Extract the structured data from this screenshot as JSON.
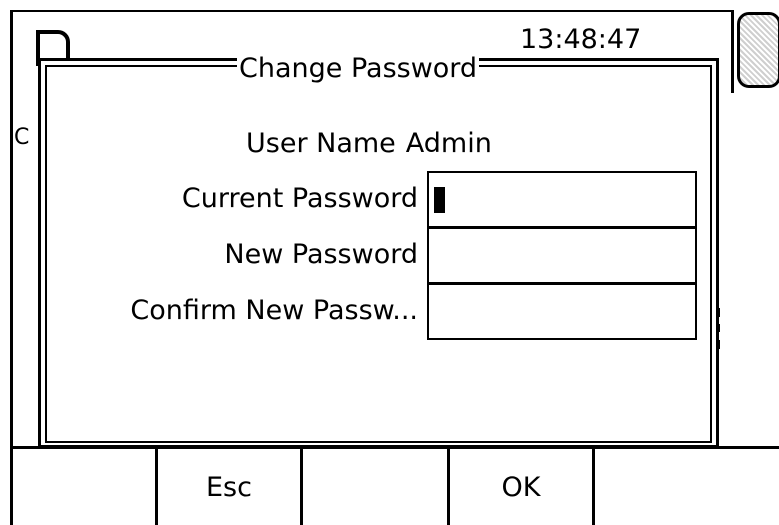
{
  "status_bar": {
    "clock": "13:48:47"
  },
  "background": {
    "partial_char": "C"
  },
  "dialog": {
    "title": "Change Password",
    "user_name_label": "User Name",
    "user_name_value": "Admin",
    "fields": [
      {
        "label": "Current Password",
        "value": "",
        "focused": true
      },
      {
        "label": "New Password",
        "value": "",
        "focused": false
      },
      {
        "label": "Confirm New Passw...",
        "value": "",
        "focused": false
      }
    ]
  },
  "softkeys": {
    "key1": "",
    "key2": "Esc",
    "key3": "",
    "key4": "OK",
    "key5": ""
  },
  "colors": {
    "foreground": "#000000",
    "background": "#ffffff"
  }
}
